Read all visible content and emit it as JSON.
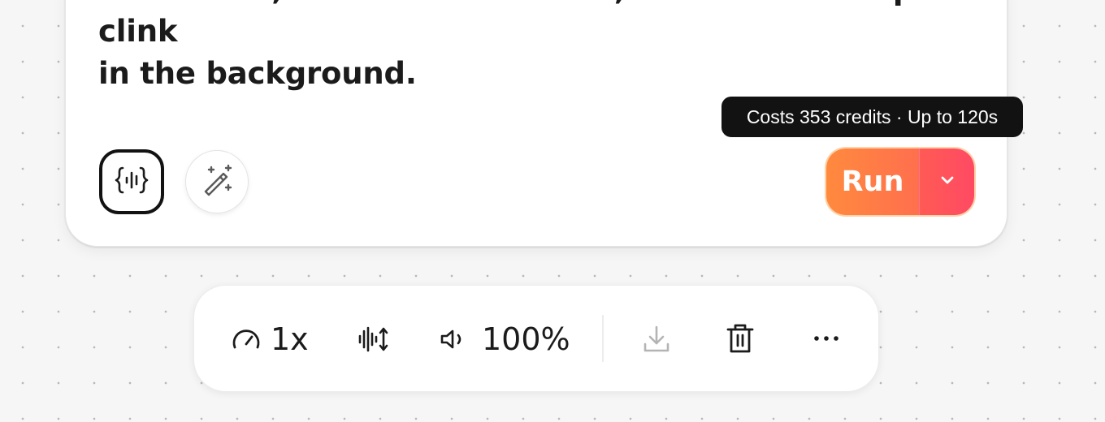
{
  "prompt": {
    "text": "room tone, rain on the window, and a coffee cup clink\nin the background."
  },
  "toolbar": {
    "variables_icon": "audio-braces-icon",
    "enhance_icon": "magic-wand-icon"
  },
  "run": {
    "label": "Run",
    "dropdown_icon": "chevron-down-icon",
    "tooltip": "Costs 353 credits · Up to 120s",
    "gradient_start": "#ff8a3d",
    "gradient_end": "#ff4a63"
  },
  "player": {
    "speed_icon": "gauge-icon",
    "speed_label": "1x",
    "waveform_icon": "waveform-adjust-icon",
    "volume_icon": "speaker-icon",
    "volume_label": "100%",
    "download_icon": "download-icon",
    "delete_icon": "trash-icon",
    "more_icon": "more-horizontal-icon"
  }
}
